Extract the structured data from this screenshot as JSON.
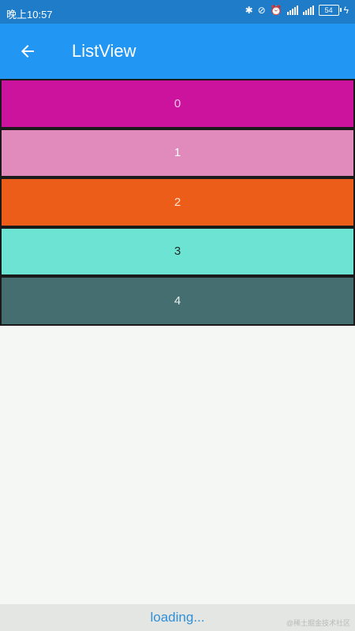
{
  "status_bar": {
    "time": "晚上10:57",
    "icons": [
      "bluetooth-icon",
      "data-saver-icon",
      "alarm-icon",
      "signal-4g-icon",
      "signal-icon",
      "battery-icon"
    ],
    "battery_level": "54"
  },
  "app_bar": {
    "title": "ListView",
    "back_icon": "arrow-left-icon",
    "color": "#2196f3"
  },
  "list": {
    "items": [
      {
        "label": "0",
        "color": "#cc139e",
        "text_color": "#f4c4e8"
      },
      {
        "label": "1",
        "color": "#e08bbb",
        "text_color": "#ffffff"
      },
      {
        "label": "2",
        "color": "#ec5d19",
        "text_color": "#ffe2cf"
      },
      {
        "label": "3",
        "color": "#6de3d3",
        "text_color": "#1b2a27"
      },
      {
        "label": "4",
        "color": "#456e70",
        "text_color": "#e8f1f1"
      }
    ]
  },
  "footer": {
    "loading_text": "loading...",
    "watermark": "@稀土掘金技术社区"
  }
}
